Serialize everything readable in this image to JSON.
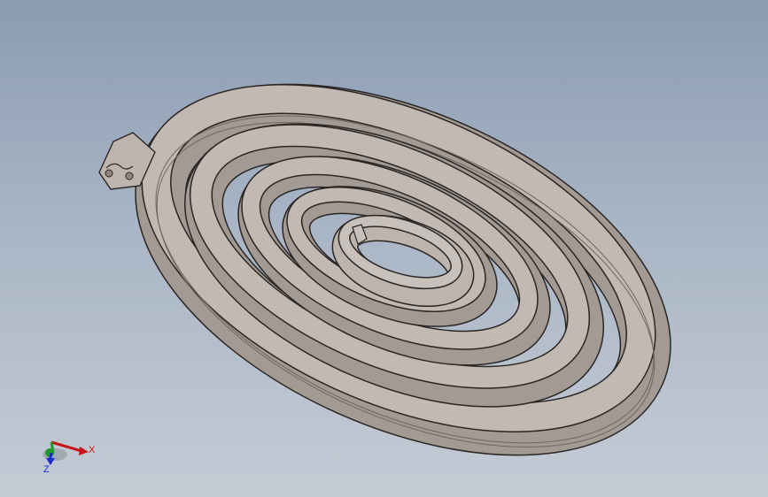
{
  "viewport": {
    "background_top": "#8a9bb2",
    "background_bottom": "#c4cbd5"
  },
  "model": {
    "part_color": "#bdb4ad",
    "edge_color": "#2a2624",
    "shadow_color": "#8f8680"
  },
  "triad": {
    "x_label": "X",
    "z_label": "Z",
    "x_color": "#c8141a",
    "y_color": "#1e9a2a",
    "z_color": "#1e2ad0"
  }
}
